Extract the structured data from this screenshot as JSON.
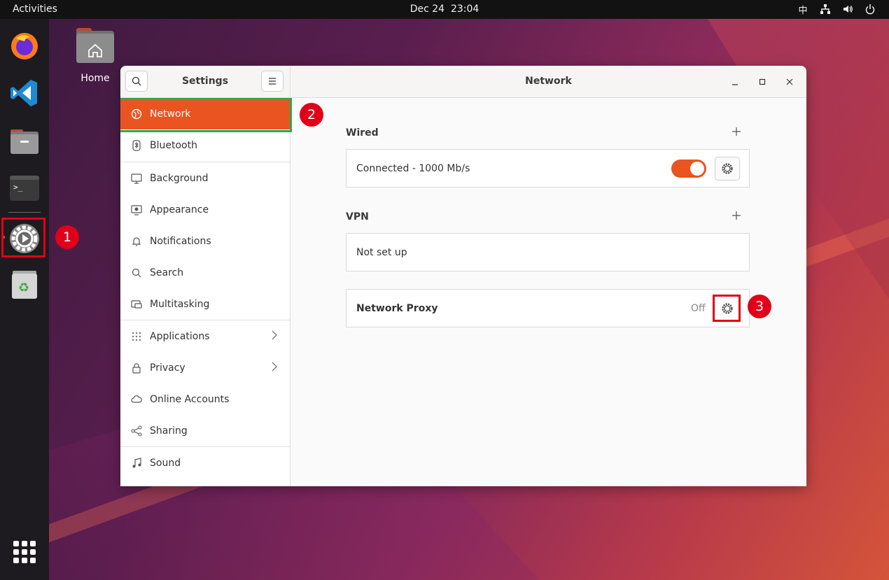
{
  "topbar": {
    "activities": "Activities",
    "date": "Dec 24",
    "time": "23:04",
    "input_method": "中"
  },
  "desktop": {
    "home_label": "Home"
  },
  "annotations": [
    "1",
    "2",
    "3"
  ],
  "settings": {
    "sidebar_title": "Settings",
    "nav": [
      {
        "label": "Network",
        "icon": "network-icon"
      },
      {
        "label": "Bluetooth",
        "icon": "bluetooth-icon"
      },
      {
        "label": "Background",
        "icon": "background-icon"
      },
      {
        "label": "Appearance",
        "icon": "appearance-icon"
      },
      {
        "label": "Notifications",
        "icon": "bell-icon"
      },
      {
        "label": "Search",
        "icon": "search-icon"
      },
      {
        "label": "Multitasking",
        "icon": "multitasking-icon"
      },
      {
        "label": "Applications",
        "icon": "apps-icon"
      },
      {
        "label": "Privacy",
        "icon": "lock-icon"
      },
      {
        "label": "Online Accounts",
        "icon": "cloud-icon"
      },
      {
        "label": "Sharing",
        "icon": "share-icon"
      },
      {
        "label": "Sound",
        "icon": "music-note-icon"
      }
    ],
    "page_title": "Network",
    "wired": {
      "label": "Wired",
      "status": "Connected - 1000 Mb/s",
      "enabled": true
    },
    "vpn": {
      "label": "VPN",
      "status": "Not set up"
    },
    "proxy": {
      "label": "Network Proxy",
      "status": "Off"
    }
  },
  "colors": {
    "accent": "#e95420",
    "annotation_red": "#e0001a",
    "highlight_green": "#2fa84f"
  }
}
